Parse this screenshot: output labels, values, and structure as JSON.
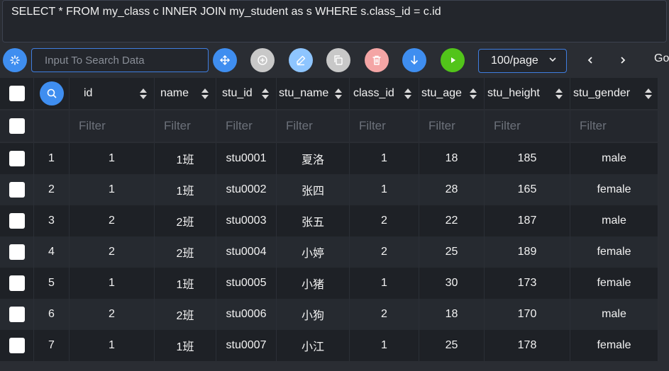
{
  "query": {
    "sql": "SELECT * FROM my_class c INNER JOIN my_student as s WHERE s.class_id = c.id"
  },
  "toolbar": {
    "search_placeholder": "Input To Search Data",
    "page_size": "100/page",
    "go_label": "Go",
    "prev_label": "‹",
    "next_label": "›",
    "colors": {
      "blue": "#3f8ef0",
      "gray": "#c8c8c8",
      "light_blue": "#8ec5ff",
      "red": "#f4a5a5",
      "green": "#52c41a"
    }
  },
  "table": {
    "columns": [
      "id",
      "name",
      "stu_id",
      "stu_name",
      "class_id",
      "stu_age",
      "stu_height",
      "stu_gender"
    ],
    "filter_placeholder": "Filter",
    "rows": [
      {
        "index": "1",
        "id": "1",
        "name": "1班",
        "stu_id": "stu0001",
        "stu_name": "夏洛",
        "class_id": "1",
        "stu_age": "18",
        "stu_height": "185",
        "stu_gender": "male"
      },
      {
        "index": "2",
        "id": "1",
        "name": "1班",
        "stu_id": "stu0002",
        "stu_name": "张四",
        "class_id": "1",
        "stu_age": "28",
        "stu_height": "165",
        "stu_gender": "female"
      },
      {
        "index": "3",
        "id": "2",
        "name": "2班",
        "stu_id": "stu0003",
        "stu_name": "张五",
        "class_id": "2",
        "stu_age": "22",
        "stu_height": "187",
        "stu_gender": "male"
      },
      {
        "index": "4",
        "id": "2",
        "name": "2班",
        "stu_id": "stu0004",
        "stu_name": "小婷",
        "class_id": "2",
        "stu_age": "25",
        "stu_height": "189",
        "stu_gender": "female"
      },
      {
        "index": "5",
        "id": "1",
        "name": "1班",
        "stu_id": "stu0005",
        "stu_name": "小猪",
        "class_id": "1",
        "stu_age": "30",
        "stu_height": "173",
        "stu_gender": "female"
      },
      {
        "index": "6",
        "id": "2",
        "name": "2班",
        "stu_id": "stu0006",
        "stu_name": "小狗",
        "class_id": "2",
        "stu_age": "18",
        "stu_height": "170",
        "stu_gender": "male"
      },
      {
        "index": "7",
        "id": "1",
        "name": "1班",
        "stu_id": "stu0007",
        "stu_name": "小江",
        "class_id": "1",
        "stu_age": "25",
        "stu_height": "178",
        "stu_gender": "female"
      }
    ]
  }
}
